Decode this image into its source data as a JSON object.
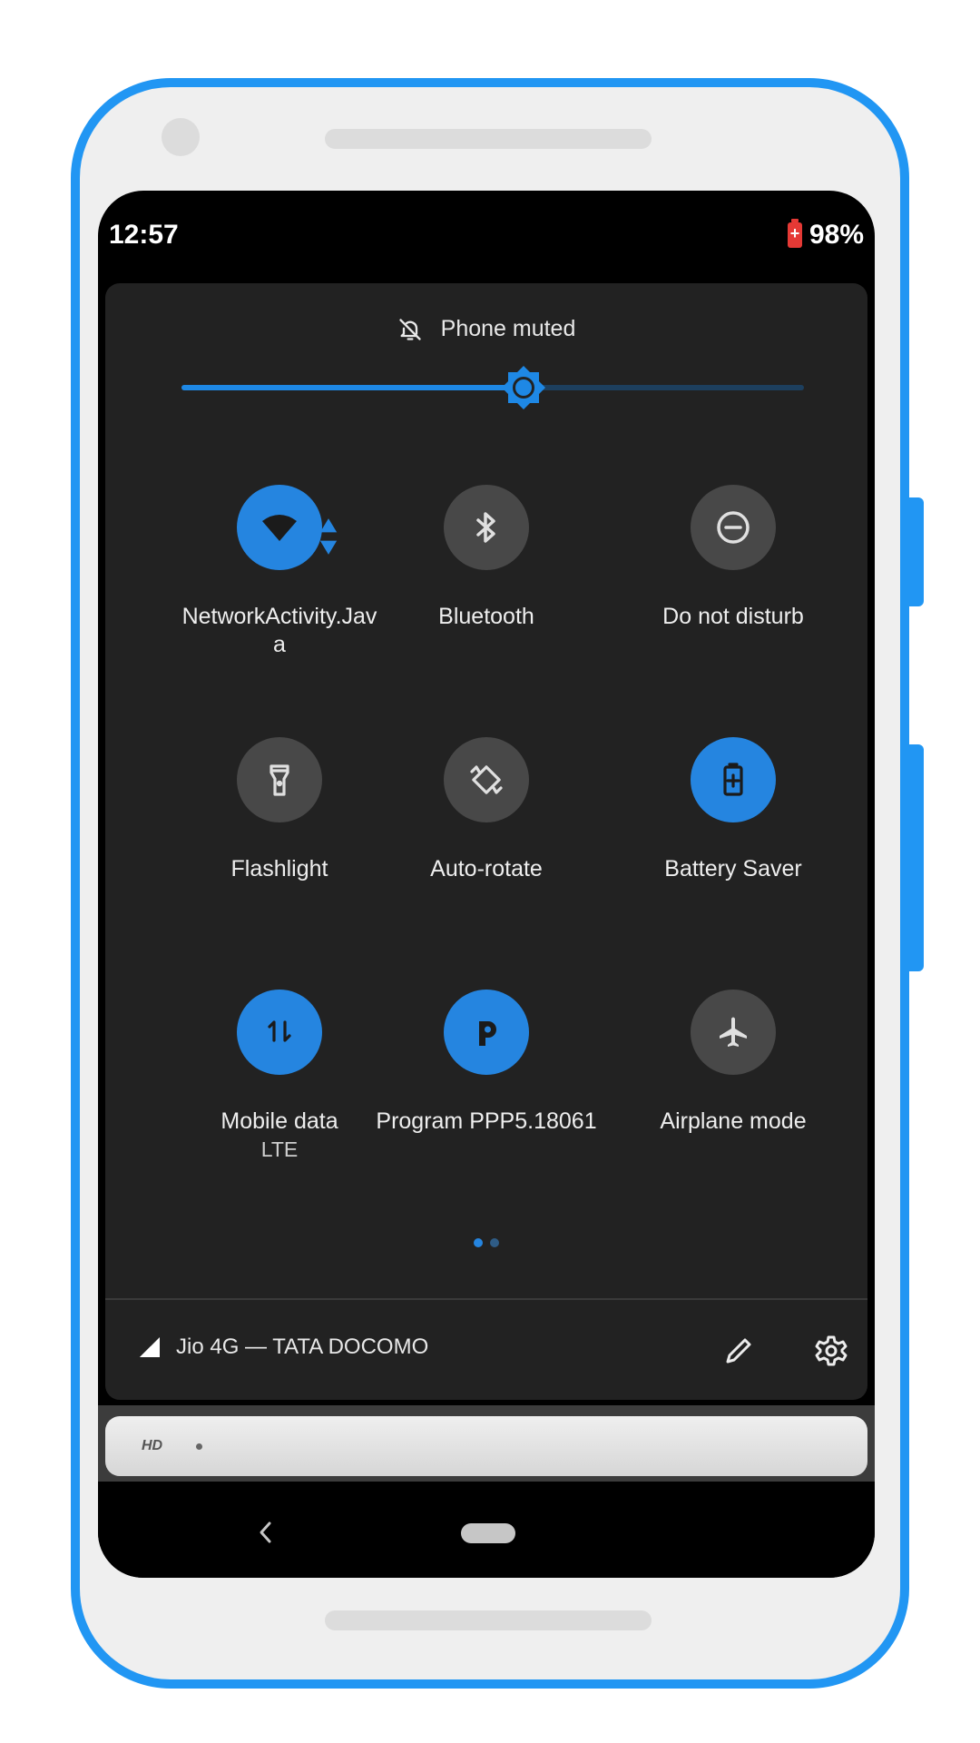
{
  "status_bar": {
    "time": "12:57",
    "battery_percent": "98%",
    "battery_icon": "battery-charging-icon"
  },
  "quick_settings": {
    "ringer_status": "Phone muted",
    "brightness_level": 0.55,
    "tiles": [
      {
        "label": "NetworkActivity.Java",
        "sub": "",
        "icon": "wifi-icon",
        "active": true
      },
      {
        "label": "Bluetooth",
        "sub": "",
        "icon": "bluetooth-icon",
        "active": false
      },
      {
        "label": "Do not disturb",
        "sub": "",
        "icon": "do-not-disturb-icon",
        "active": false
      },
      {
        "label": "Flashlight",
        "sub": "",
        "icon": "flashlight-icon",
        "active": false
      },
      {
        "label": "Auto-rotate",
        "sub": "",
        "icon": "auto-rotate-icon",
        "active": false
      },
      {
        "label": "Battery Saver",
        "sub": "",
        "icon": "battery-saver-icon",
        "active": true
      },
      {
        "label": "Mobile data",
        "sub": "LTE",
        "icon": "mobile-data-icon",
        "active": true
      },
      {
        "label": "Program PPP5.18061",
        "sub": "",
        "icon": "program-p-icon",
        "active": true
      },
      {
        "label": "Airplane mode",
        "sub": "",
        "icon": "airplane-icon",
        "active": false
      }
    ],
    "page_count": 2,
    "current_page": 1,
    "carrier": "Jio 4G — TATA DOCOMO"
  },
  "notification": {
    "badge": "HD"
  },
  "colors": {
    "accent": "#2585e0",
    "frame": "#2196f3",
    "panel": "#222222",
    "tile_off": "#484848"
  }
}
